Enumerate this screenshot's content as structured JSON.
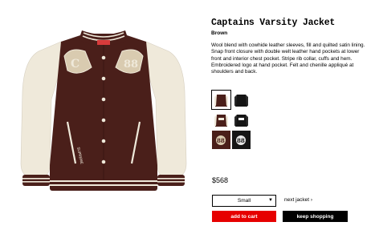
{
  "product": {
    "title": "Captains Varsity Jacket",
    "color": "Brown",
    "description": "Wool blend with cowhide leather sleeves, fill and quilted satin lining. Snap front closure with double welt leather hand pockets at lower front and interior chest pocket. Stripe rib collar, cuffs and hem. Embroidered logo at hand pocket. Felt and chenille appliqué at shoulders and back.",
    "price": "$568",
    "image_icon": "varsity-jacket-image"
  },
  "swatches": [
    {
      "name": "brown-front",
      "color": "#4a1f1a",
      "accent": "#efe9da",
      "selected": true
    },
    {
      "name": "black-front",
      "color": "#151515",
      "accent": "#ffffff",
      "selected": false
    },
    {
      "name": "brown-back",
      "color": "#4a1f1a",
      "accent": "#efe9da",
      "selected": false
    },
    {
      "name": "black-back",
      "color": "#151515",
      "accent": "#ffffff",
      "selected": false
    },
    {
      "name": "brown-detail",
      "color": "#4a1f1a",
      "accent": "#efe9da",
      "selected": false
    },
    {
      "name": "black-detail",
      "color": "#151515",
      "accent": "#ffffff",
      "selected": false
    }
  ],
  "size": {
    "selected": "Small",
    "chevron_icon": "chevron-down-icon"
  },
  "links": {
    "next": "next jacket",
    "next_icon": "chevron-right-icon"
  },
  "buttons": {
    "add_to_cart": "add to cart",
    "keep_shopping": "keep shopping"
  },
  "colors": {
    "accent_red": "#e60000",
    "brown": "#4a1f1a",
    "cream": "#efe9da"
  }
}
